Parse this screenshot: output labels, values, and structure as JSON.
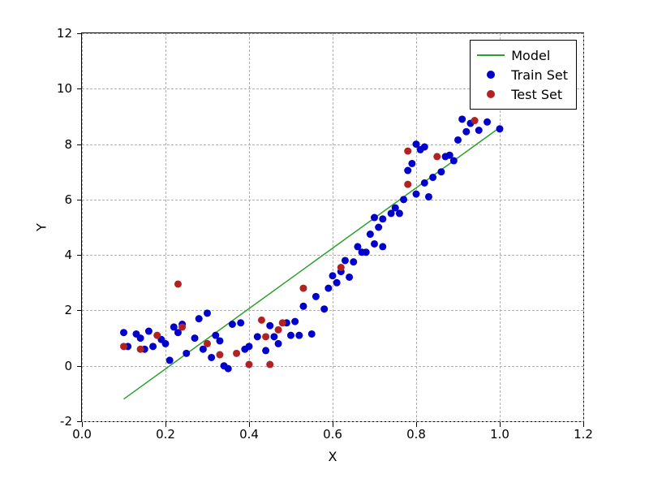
{
  "chart_data": {
    "type": "scatter",
    "xlabel": "X",
    "ylabel": "Y",
    "xlim": [
      0.0,
      1.2
    ],
    "ylim": [
      -2,
      12
    ],
    "xticks": [
      0.0,
      0.2,
      0.4,
      0.6,
      0.8,
      1.0,
      1.2
    ],
    "yticks": [
      -2,
      0,
      2,
      4,
      6,
      8,
      10,
      12
    ],
    "grid": true,
    "colors": {
      "model_line": "#2ca02c",
      "train_point": "#0000cc",
      "test_point": "#b22222"
    },
    "series": [
      {
        "name": "Model",
        "type": "line",
        "x": [
          0.1,
          1.0
        ],
        "y": [
          -1.2,
          8.6
        ]
      },
      {
        "name": "Train Set",
        "type": "scatter",
        "points": [
          [
            0.1,
            1.2
          ],
          [
            0.11,
            0.7
          ],
          [
            0.13,
            1.15
          ],
          [
            0.14,
            1.0
          ],
          [
            0.15,
            0.6
          ],
          [
            0.16,
            1.25
          ],
          [
            0.17,
            0.7
          ],
          [
            0.19,
            0.95
          ],
          [
            0.2,
            0.8
          ],
          [
            0.21,
            0.2
          ],
          [
            0.22,
            1.4
          ],
          [
            0.23,
            1.2
          ],
          [
            0.24,
            1.5
          ],
          [
            0.25,
            0.45
          ],
          [
            0.27,
            1.0
          ],
          [
            0.28,
            1.7
          ],
          [
            0.29,
            0.6
          ],
          [
            0.3,
            1.9
          ],
          [
            0.31,
            0.3
          ],
          [
            0.32,
            1.1
          ],
          [
            0.33,
            0.9
          ],
          [
            0.34,
            0.0
          ],
          [
            0.35,
            -0.1
          ],
          [
            0.36,
            1.5
          ],
          [
            0.38,
            1.55
          ],
          [
            0.39,
            0.6
          ],
          [
            0.4,
            0.7
          ],
          [
            0.42,
            1.05
          ],
          [
            0.44,
            0.55
          ],
          [
            0.45,
            1.45
          ],
          [
            0.46,
            1.05
          ],
          [
            0.47,
            0.8
          ],
          [
            0.49,
            1.55
          ],
          [
            0.5,
            1.1
          ],
          [
            0.51,
            1.6
          ],
          [
            0.52,
            1.1
          ],
          [
            0.53,
            2.15
          ],
          [
            0.55,
            1.15
          ],
          [
            0.56,
            2.5
          ],
          [
            0.58,
            2.05
          ],
          [
            0.59,
            2.8
          ],
          [
            0.6,
            3.25
          ],
          [
            0.61,
            3.0
          ],
          [
            0.62,
            3.4
          ],
          [
            0.63,
            3.8
          ],
          [
            0.64,
            3.2
          ],
          [
            0.65,
            3.75
          ],
          [
            0.66,
            4.3
          ],
          [
            0.67,
            4.1
          ],
          [
            0.68,
            4.1
          ],
          [
            0.69,
            4.75
          ],
          [
            0.7,
            4.4
          ],
          [
            0.7,
            5.35
          ],
          [
            0.71,
            5.0
          ],
          [
            0.72,
            4.3
          ],
          [
            0.72,
            5.3
          ],
          [
            0.74,
            5.5
          ],
          [
            0.75,
            5.7
          ],
          [
            0.76,
            5.5
          ],
          [
            0.77,
            6.0
          ],
          [
            0.78,
            7.05
          ],
          [
            0.79,
            7.3
          ],
          [
            0.8,
            6.2
          ],
          [
            0.8,
            8.0
          ],
          [
            0.81,
            7.8
          ],
          [
            0.82,
            7.9
          ],
          [
            0.82,
            6.6
          ],
          [
            0.83,
            6.1
          ],
          [
            0.84,
            6.8
          ],
          [
            0.86,
            7.0
          ],
          [
            0.87,
            7.55
          ],
          [
            0.88,
            7.6
          ],
          [
            0.89,
            7.4
          ],
          [
            0.9,
            8.15
          ],
          [
            0.91,
            8.9
          ],
          [
            0.92,
            8.45
          ],
          [
            0.93,
            8.75
          ],
          [
            0.95,
            8.5
          ],
          [
            0.97,
            8.8
          ],
          [
            1.0,
            8.55
          ]
        ]
      },
      {
        "name": "Test Set",
        "type": "scatter",
        "points": [
          [
            0.1,
            0.7
          ],
          [
            0.14,
            0.6
          ],
          [
            0.18,
            1.1
          ],
          [
            0.23,
            2.95
          ],
          [
            0.24,
            1.4
          ],
          [
            0.3,
            0.8
          ],
          [
            0.33,
            0.4
          ],
          [
            0.37,
            0.45
          ],
          [
            0.4,
            0.05
          ],
          [
            0.43,
            1.65
          ],
          [
            0.44,
            1.05
          ],
          [
            0.45,
            0.05
          ],
          [
            0.47,
            1.3
          ],
          [
            0.48,
            1.55
          ],
          [
            0.53,
            2.8
          ],
          [
            0.62,
            3.55
          ],
          [
            0.78,
            6.55
          ],
          [
            0.78,
            7.75
          ],
          [
            0.85,
            7.55
          ],
          [
            0.94,
            8.85
          ]
        ]
      }
    ],
    "legend": {
      "position": "upper right",
      "entries": [
        "Model",
        "Train Set",
        "Test Set"
      ]
    }
  },
  "xtick_labels": [
    "0.0",
    "0.2",
    "0.4",
    "0.6",
    "0.8",
    "1.0",
    "1.2"
  ],
  "ytick_labels": [
    "-2",
    "0",
    "2",
    "4",
    "6",
    "8",
    "10",
    "12"
  ]
}
